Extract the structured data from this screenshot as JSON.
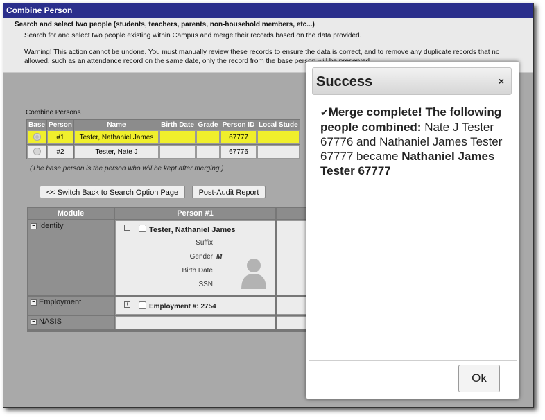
{
  "window": {
    "title": "Combine Person"
  },
  "header": {
    "heading": "Search and select two people (students, teachers, parents, non-household members, etc...)",
    "description": "Search for and select two people existing within Campus and merge their records based on the data provided.",
    "warning_line1": "Warning! This action cannot be undone. You must manually review these records to ensure the data is correct, and to remove any duplicate records that no",
    "warning_line2": "allowed, such as an attendance record on the same date, only the record from the base person will be preserved."
  },
  "combine_persons": {
    "label": "Combine Persons",
    "columns": [
      "Base",
      "Person",
      "Name",
      "Birth Date",
      "Grade",
      "Person ID",
      "Local Stude"
    ],
    "rows": [
      {
        "person": "#1",
        "name": "Tester, Nathaniel James",
        "birth_date": "",
        "grade": "",
        "person_id": "67777",
        "local": ""
      },
      {
        "person": "#2",
        "name": "Tester, Nate J",
        "birth_date": "",
        "grade": "",
        "person_id": "67776",
        "local": ""
      }
    ],
    "note": "(The base person is the person who will be kept after merging.)"
  },
  "buttons": {
    "switch_back": "<< Switch Back to Search Option Page",
    "post_audit": "Post-Audit Report"
  },
  "modules": {
    "headers": {
      "module": "Module",
      "person1": "Person #1"
    },
    "identity": {
      "label": "Identity",
      "person_name": "Tester, Nathaniel James",
      "fields": [
        {
          "label": "Suffix",
          "value": ""
        },
        {
          "label": "Gender",
          "value": "M"
        },
        {
          "label": "Birth Date",
          "value": ""
        },
        {
          "label": "SSN",
          "value": ""
        }
      ]
    },
    "employment": {
      "label": "Employment",
      "value": "Employment #: 2754"
    },
    "nasis": {
      "label": "NASIS"
    }
  },
  "dialog": {
    "title": "Success",
    "close": "×",
    "check": "✔",
    "bold1": "Merge complete! The following people combined:",
    "text1": "Nate J Tester 67776 and Nathaniel James Tester 67777 became",
    "bold2": "Nathaniel James Tester 67777",
    "ok": "Ok"
  }
}
